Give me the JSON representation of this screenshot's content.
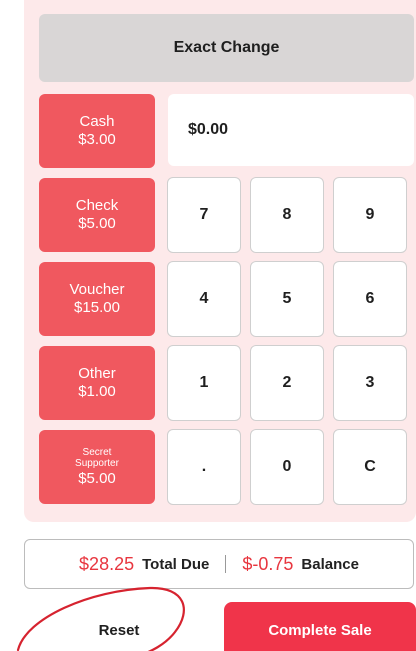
{
  "pad": {
    "exact_change_label": "Exact Change",
    "amount_value": "$0.00"
  },
  "payment_methods": [
    {
      "name": "Cash",
      "amount": "$3.00"
    },
    {
      "name": "Check",
      "amount": "$5.00"
    },
    {
      "name": "Voucher",
      "amount": "$15.00"
    },
    {
      "name": "Other",
      "amount": "$1.00"
    },
    {
      "name": "Secret\nSupporter",
      "amount": "$5.00"
    }
  ],
  "keys": [
    "7",
    "8",
    "9",
    "4",
    "5",
    "6",
    "1",
    "2",
    "3",
    ".",
    "0",
    "C"
  ],
  "summary": {
    "total_amount": "$28.25",
    "total_label": "Total Due",
    "balance_amount": "$-0.75",
    "balance_label": "Balance"
  },
  "actions": {
    "reset_label": "Reset",
    "complete_label": "Complete Sale"
  },
  "colors": {
    "accent": "#f0585f",
    "complete": "#f0344a",
    "panel": "#fde9ea",
    "annotation": "#d6232f"
  }
}
